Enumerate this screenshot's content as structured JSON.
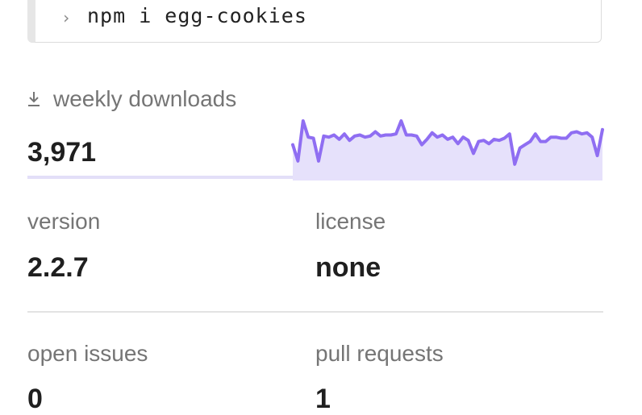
{
  "install": {
    "prompt_symbol": "›",
    "command": "npm i egg-cookies"
  },
  "downloads": {
    "label": "weekly downloads",
    "value": "3,971",
    "icon": "download-icon",
    "trend": [
      30,
      15,
      52,
      37,
      36,
      15,
      38,
      37,
      39,
      35,
      40,
      34,
      38,
      39,
      37,
      38,
      42,
      38,
      39,
      39,
      40,
      52,
      39,
      39,
      38,
      30,
      35,
      41,
      37,
      39,
      35,
      37,
      31,
      37,
      34,
      22,
      33,
      34,
      31,
      35,
      34,
      36,
      40,
      12,
      27,
      30,
      33,
      40,
      33,
      33,
      37,
      37,
      36,
      36,
      41,
      42,
      40,
      41,
      37,
      20,
      44
    ],
    "line_color": "#8f6ef2",
    "fill_color": "#e6e1fb"
  },
  "version": {
    "label": "version",
    "value": "2.2.7"
  },
  "license": {
    "label": "license",
    "value": "none"
  },
  "open_issues": {
    "label": "open issues",
    "value": "0"
  },
  "pull_requests": {
    "label": "pull requests",
    "value": "1"
  }
}
